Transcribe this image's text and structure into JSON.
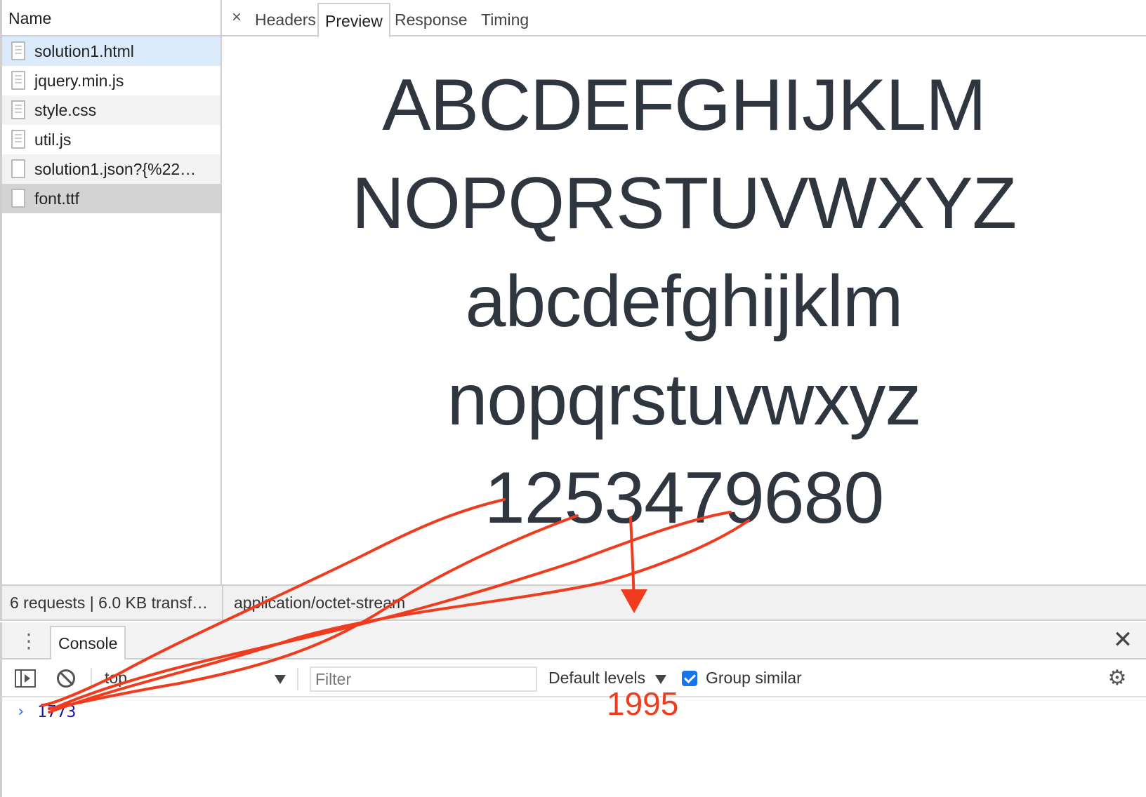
{
  "network": {
    "name_header": "Name",
    "files": [
      {
        "name": "solution1.html",
        "icon": "document-icon",
        "state": "selected"
      },
      {
        "name": "jquery.min.js",
        "icon": "document-icon",
        "state": "normal"
      },
      {
        "name": "style.css",
        "icon": "document-icon",
        "state": "alt"
      },
      {
        "name": "util.js",
        "icon": "document-icon",
        "state": "normal"
      },
      {
        "name": "solution1.json?{%22…",
        "icon": "blank-file-icon",
        "state": "alt"
      },
      {
        "name": "font.ttf",
        "icon": "blank-file-icon",
        "state": "hover"
      }
    ],
    "tabs": {
      "close": "×",
      "headers": "Headers",
      "preview": "Preview",
      "response": "Response",
      "timing": "Timing"
    },
    "preview_lines": [
      "ABCDEFGHIJKLM",
      "NOPQRSTUVWXYZ",
      "abcdefghijklm",
      "nopqrstuvwxyz",
      "1253479680"
    ],
    "status_left": "6 requests | 6.0 KB transf…",
    "status_right": "application/octet-stream"
  },
  "drawer": {
    "menu_icon": "⋮",
    "console_tab": "Console",
    "close_icon": "✕"
  },
  "console_toolbar": {
    "context": "top",
    "filter_placeholder": "Filter",
    "levels": "Default levels",
    "group_similar": "Group similar",
    "group_similar_checked": true,
    "settings_icon": "⚙"
  },
  "console_output": {
    "chevron": "›",
    "value": "1773"
  },
  "annotation": {
    "text": "1995",
    "color": "#f03c1e"
  },
  "colors": {
    "selected_row": "#dcebfb",
    "accent": "#1a73e8",
    "preview_text": "#2f3640",
    "console_number": "#1a1aa6"
  }
}
